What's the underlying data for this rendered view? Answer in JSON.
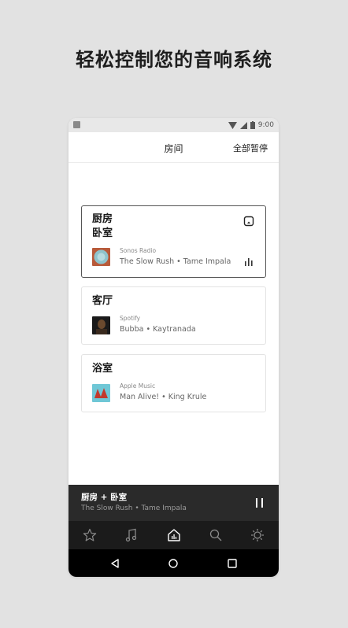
{
  "headline": "轻松控制您的音响系统",
  "status_bar": {
    "time": "9:00"
  },
  "top_bar": {
    "title": "房间",
    "action": "全部暂停"
  },
  "rooms": [
    {
      "names": [
        "厨房",
        "卧室"
      ],
      "source": "Sonos Radio",
      "track": "The Slow Rush • Tame Impala",
      "active": true
    },
    {
      "names": [
        "客厅"
      ],
      "source": "Spotify",
      "track": "Bubba • Kaytranada",
      "active": false
    },
    {
      "names": [
        "浴室"
      ],
      "source": "Apple Music",
      "track": "Man Alive! • King Krule",
      "active": false
    }
  ],
  "now_playing": {
    "group": "厨房 + 卧室",
    "track": "The Slow Rush • Tame Impala"
  },
  "tabs": [
    {
      "icon": "star-icon",
      "label": "favorites"
    },
    {
      "icon": "music-note-icon",
      "label": "music"
    },
    {
      "icon": "home-rooms-icon",
      "label": "rooms",
      "active": true
    },
    {
      "icon": "search-icon",
      "label": "search"
    },
    {
      "icon": "settings-icon",
      "label": "settings"
    }
  ],
  "colors": {
    "active_border": "#555555",
    "player_bg": "#2a2a2a",
    "tab_bg": "#1b1b1b"
  }
}
